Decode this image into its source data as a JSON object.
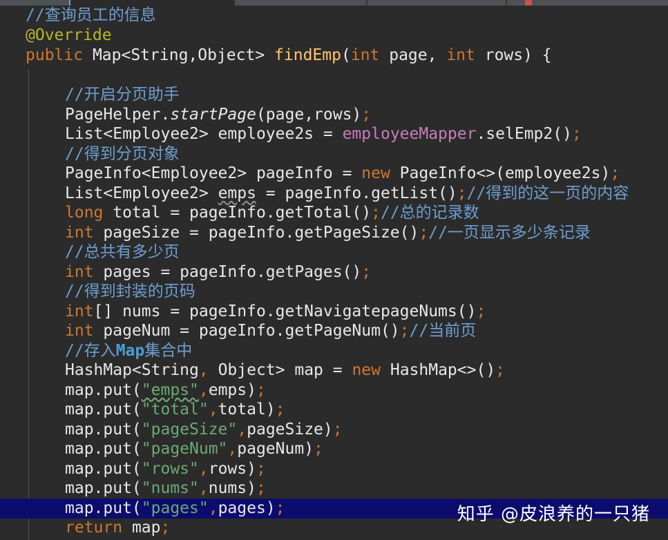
{
  "code": {
    "l1_comment": "//查询员工的信息",
    "l2_annotation": "@Override",
    "l3_kw_public": "public",
    "l3_type": " Map<String,Object> ",
    "l3_method": "findEmp",
    "l3_paren_open": "(",
    "l3_kw_int1": "int",
    "l3_p1": " page, ",
    "l3_kw_int2": "int",
    "l3_p2": " rows) {",
    "l5_comment": "//开启分页助手",
    "l6_a": "PageHelper.",
    "l6_b": "startPage",
    "l6_c": "(page,rows)",
    "l6_semi": ";",
    "l7_a": "List<Employee2> employee2s = ",
    "l7_field": "employeeMapper",
    "l7_b": ".selEmp2()",
    "l7_semi": ";",
    "l8_comment": "//得到分页对象",
    "l9_a": "PageInfo<Employee2> pageInfo = ",
    "l9_kw": "new",
    "l9_b": " PageInfo<>(employee2s)",
    "l9_semi": ";",
    "l10_a": "List<Employee2> ",
    "l10_var": "emps",
    "l10_b": " = pageInfo.getList()",
    "l10_semi": ";",
    "l10_comment": "//得到的这一页的内容",
    "l11_kw": "long",
    "l11_a": " total = pageInfo.getTotal()",
    "l11_semi": ";",
    "l11_comment": "//总的记录数",
    "l12_kw": "int",
    "l12_a": " pageSize = pageInfo.getPageSize()",
    "l12_semi": ";",
    "l12_comment": "//一页显示多少条记录",
    "l13_comment": "//总共有多少页",
    "l14_kw": "int",
    "l14_a": " pages = pageInfo.getPages()",
    "l14_semi": ";",
    "l15_comment": "//得到封装的页码",
    "l16_kw": "int",
    "l16_a": "[] nums = pageInfo.getNavigatepageNums()",
    "l16_semi": ";",
    "l17_kw": "int",
    "l17_a": " pageNum = pageInfo.getPageNum()",
    "l17_semi": ";",
    "l17_comment": "//当前页",
    "l18_comment_a": "//存入",
    "l18_comment_b": "Map",
    "l18_comment_c": "集合中",
    "l19_a": "HashMap<String",
    "l19_comma": ",",
    "l19_b": " Object> map = ",
    "l19_kw": "new",
    "l19_c": " HashMap<>()",
    "l19_semi": ";",
    "put_prefix": "map.put(",
    "put_suffix_semi": ";",
    "puts": [
      {
        "key": "\"emps\"",
        "comma": ",",
        "val": "emps)"
      },
      {
        "key": "\"total\"",
        "comma": ",",
        "val": "total)"
      },
      {
        "key": "\"pageSize\"",
        "comma": ",",
        "val": "pageSize)"
      },
      {
        "key": "\"pageNum\"",
        "comma": ",",
        "val": "pageNum)"
      },
      {
        "key": "\"rows\"",
        "comma": ",",
        "val": "rows)"
      },
      {
        "key": "\"nums\"",
        "comma": ",",
        "val": "nums)"
      },
      {
        "key": "\"pages\"",
        "comma": ",",
        "val": "pages)"
      }
    ],
    "l27_kw": "return",
    "l27_a": " map",
    "l27_semi": ";"
  },
  "watermark": "知乎 @皮浪养的一只猪",
  "colors": {
    "background": "#2b2b2b",
    "keyword": "#cc7832",
    "comment": "#6d9fd1",
    "string": "#6aab73",
    "field": "#c77dbb",
    "method": "#ffc66d",
    "annotation": "#bbb529",
    "highlight": "#0c0c6e"
  }
}
